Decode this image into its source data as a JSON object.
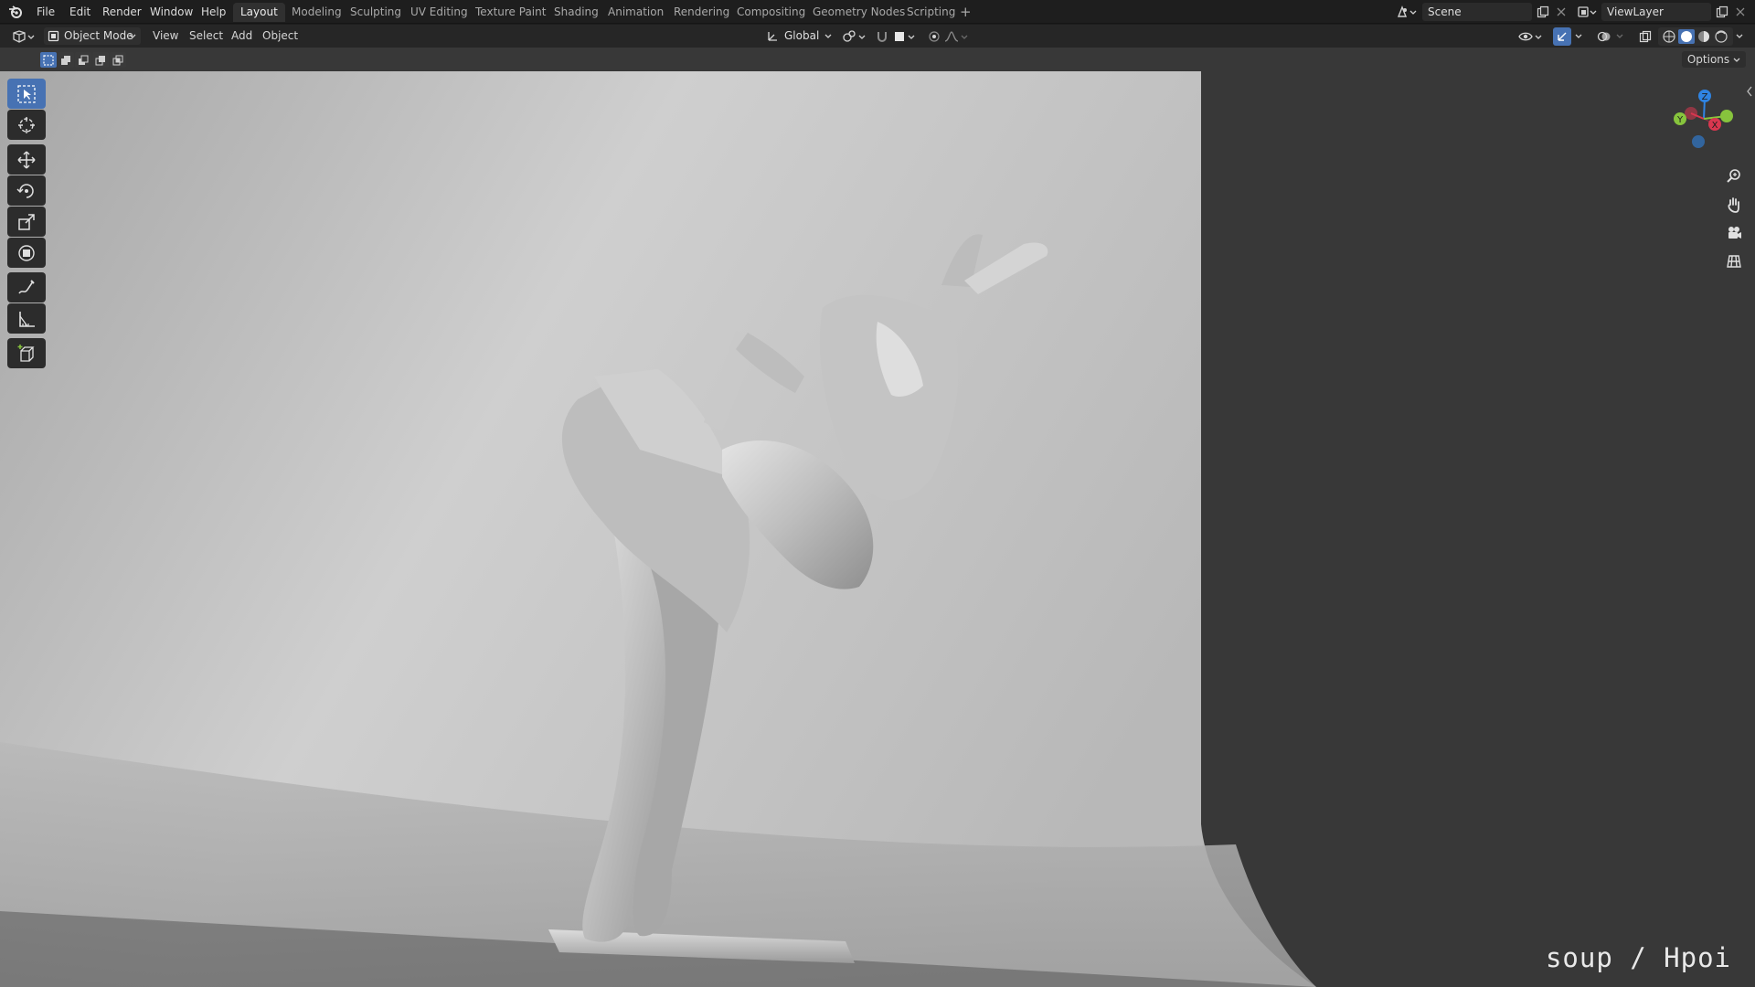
{
  "app": {
    "menus": [
      "File",
      "Edit",
      "Render",
      "Window",
      "Help"
    ],
    "workspaces": [
      {
        "label": "Layout",
        "active": true
      },
      {
        "label": "Modeling",
        "active": false
      },
      {
        "label": "Sculpting",
        "active": false
      },
      {
        "label": "UV Editing",
        "active": false
      },
      {
        "label": "Texture Paint",
        "active": false
      },
      {
        "label": "Shading",
        "active": false
      },
      {
        "label": "Animation",
        "active": false
      },
      {
        "label": "Rendering",
        "active": false
      },
      {
        "label": "Compositing",
        "active": false
      },
      {
        "label": "Geometry Nodes",
        "active": false
      },
      {
        "label": "Scripting",
        "active": false
      }
    ],
    "add_workspace": "+",
    "scene_name": "Scene",
    "view_layer_name": "ViewLayer"
  },
  "header": {
    "mode": "Object Mode",
    "menus": [
      "View",
      "Select",
      "Add",
      "Object"
    ],
    "transform_orientation": "Global",
    "options_label": "Options"
  },
  "gizmo": {
    "x": "X",
    "y": "Y",
    "z": "Z"
  },
  "toolbar": [
    "select-box",
    "cursor",
    "move",
    "rotate",
    "scale",
    "transform",
    "annotate",
    "measure",
    "add-cube"
  ],
  "watermark": "soup / Hpoi",
  "colors": {
    "accent": "#4772b3",
    "axis_x": "#d9374f",
    "axis_y": "#87c43d",
    "axis_z": "#2f84e3",
    "backdrop": "#c8c8c8"
  }
}
